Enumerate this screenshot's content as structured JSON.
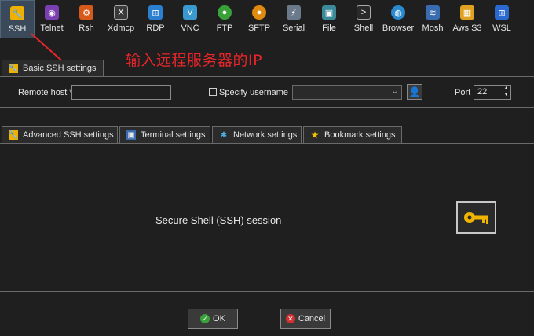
{
  "toolbar": {
    "items": [
      {
        "label": "SSH",
        "icon": "ssh-icon",
        "color": "#f0b000",
        "glyph": "🔧"
      },
      {
        "label": "Telnet",
        "icon": "telnet-icon",
        "color": "#7a3fb0",
        "glyph": "◉"
      },
      {
        "label": "Rsh",
        "icon": "rsh-icon",
        "color": "#d85a1a",
        "glyph": "⚙"
      },
      {
        "label": "Xdmcp",
        "icon": "xdmcp-icon",
        "color": "#3a3a3a",
        "glyph": "X"
      },
      {
        "label": "RDP",
        "icon": "rdp-icon",
        "color": "#2a7fd0",
        "glyph": "⊞"
      },
      {
        "label": "VNC",
        "icon": "vnc-icon",
        "color": "#3a9ad0",
        "glyph": "V"
      },
      {
        "label": "FTP",
        "icon": "ftp-icon",
        "color": "#3aa03a",
        "glyph": "●"
      },
      {
        "label": "SFTP",
        "icon": "sftp-icon",
        "color": "#e08a10",
        "glyph": "●"
      },
      {
        "label": "Serial",
        "icon": "serial-icon",
        "color": "#6a7a8a",
        "glyph": "⚡"
      },
      {
        "label": "File",
        "icon": "file-icon",
        "color": "#3a8a9a",
        "glyph": "▣"
      },
      {
        "label": "Shell",
        "icon": "shell-icon",
        "color": "#2a2a2a",
        "glyph": ">"
      },
      {
        "label": "Browser",
        "icon": "browser-icon",
        "color": "#2a8ad0",
        "glyph": "◍"
      },
      {
        "label": "Mosh",
        "icon": "mosh-icon",
        "color": "#3a6ab0",
        "glyph": "≋"
      },
      {
        "label": "Aws S3",
        "icon": "aws-s3-icon",
        "color": "#e0a020",
        "glyph": "▦"
      },
      {
        "label": "WSL",
        "icon": "wsl-icon",
        "color": "#2a6ad0",
        "glyph": "⊞"
      }
    ]
  },
  "annotation": "输入远程服务器的IP",
  "basic": {
    "tab_label": "Basic SSH settings",
    "remote_host_label": "Remote host *",
    "remote_host_value": "",
    "specify_username_label": "Specify username",
    "username_value": "",
    "port_label": "Port",
    "port_value": "22"
  },
  "tabs": [
    {
      "label": "Advanced SSH settings",
      "icon": "wrench-icon"
    },
    {
      "label": "Terminal settings",
      "icon": "terminal-icon"
    },
    {
      "label": "Network settings",
      "icon": "network-icon"
    },
    {
      "label": "Bookmark settings",
      "icon": "star-icon"
    }
  ],
  "session_text": "Secure Shell (SSH) session",
  "buttons": {
    "ok_label": "OK",
    "cancel_label": "Cancel"
  },
  "colors": {
    "background": "#1f1f1f",
    "accent_red": "#e8262a",
    "key_gold": "#f0b400"
  }
}
